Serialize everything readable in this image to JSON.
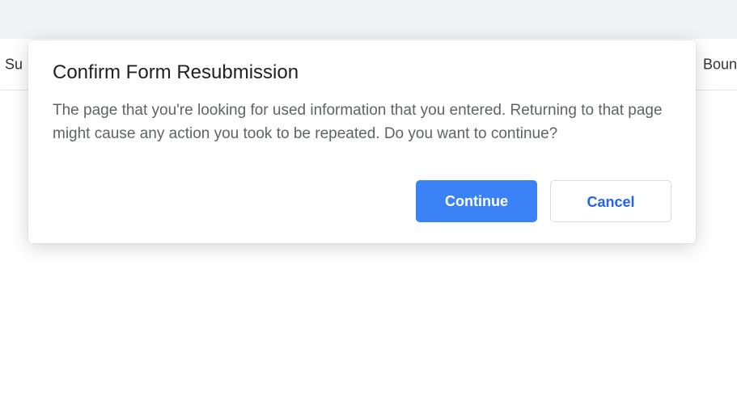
{
  "header": {
    "left_text": "Su",
    "right_text": "Boun"
  },
  "dialog": {
    "title": "Confirm Form Resubmission",
    "body": "The page that you're looking for used information that you entered. Returning to that page might cause any action you took to be repeated. Do you want to continue?",
    "continue_label": "Continue",
    "cancel_label": "Cancel"
  }
}
